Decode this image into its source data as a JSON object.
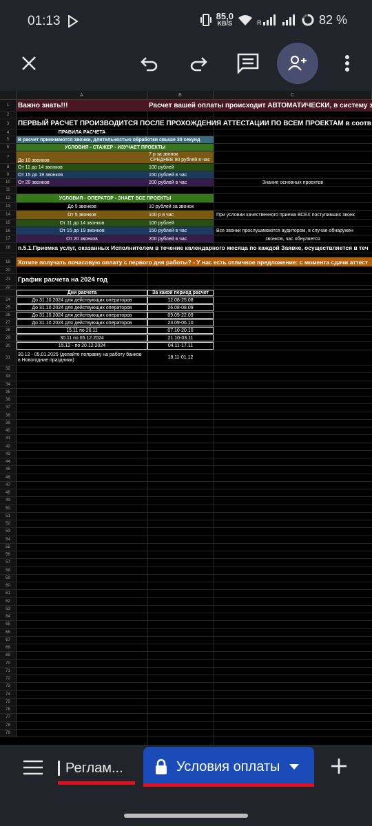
{
  "status_bar": {
    "time": "01:13",
    "speed_value": "85,0",
    "speed_unit": "KB/S",
    "battery": "82 %"
  },
  "toolbar": {
    "icons": [
      "close-icon",
      "undo-icon",
      "redo-icon",
      "comment-icon",
      "share-person-add-icon",
      "more-vert-icon"
    ]
  },
  "sheet": {
    "columns": [
      "A",
      "B",
      "C"
    ],
    "rows": [
      {
        "n": "1",
        "a": "Важно знать!!!",
        "b": "Расчет вашей оплаты происходит АВТОМАТИЧЕСКИ, в систему з",
        "c": ""
      },
      {
        "n": "2",
        "a": "",
        "b": "",
        "c": ""
      },
      {
        "n": "3",
        "a": "ПЕРВЫЙ РАСЧЕТ ПРОИЗВОДИТСЯ ПОСЛЕ ПРОХОЖДЕНИЯ АТТЕСТАЦИИ ПО ВСЕМ ПРОЕКТАМ в соотв",
        "b": "",
        "c": ""
      },
      {
        "n": "4",
        "a": "ПРАВИЛА РАСЧЕТА",
        "b": "",
        "c": ""
      },
      {
        "n": "5",
        "a": "В расчет принимаются звонки, длительностью обработки свыше 30 секунд",
        "b": "",
        "c": ""
      },
      {
        "n": "6",
        "a": "УСЛОВИЯ - СТАЖЕР - ИЗУЧАЕТ ПРОЕКТЫ",
        "b": "",
        "c": ""
      },
      {
        "n": "7",
        "a": "До 10 звонков",
        "b": "7 р за звонок",
        "b2": "СРЕДНЕЕ 90 рублей в час",
        "c": ""
      },
      {
        "n": "8",
        "a": "От 11 до 14 звонков",
        "b": "100 рублей",
        "c": ""
      },
      {
        "n": "9",
        "a": "От 15 до 19 звонков",
        "b": "150 рублей в час",
        "c": ""
      },
      {
        "n": "10",
        "a": "От 20 звонков",
        "b": "200 рублей в час",
        "c": "Знание основных проектов"
      },
      {
        "n": "11",
        "a": "",
        "b": "",
        "c": ""
      },
      {
        "n": "12",
        "a": "УСЛОВИЯ - ОПЕРАТОР - ЗНАЕТ ВСЕ ПРОЕКТЫ",
        "b": "",
        "c": ""
      },
      {
        "n": "13",
        "a": "До 5 звонков",
        "b": "10 рублей за звонок",
        "c": ""
      },
      {
        "n": "14",
        "a": "От 5 звонков",
        "b": "100 р в час",
        "c": "При условии качественного приема ВСЕХ поступивших звонк"
      },
      {
        "n": "15",
        "a": "От 11 до 14 звонков",
        "b": "100 рублей",
        "c": ""
      },
      {
        "n": "16",
        "a": "От 15 до 19 звонков",
        "b": "150 рублей в час",
        "c": "Все звонки прослушиваются аудитором, в случае обнаружен"
      },
      {
        "n": "17",
        "a": "От 20 звонков",
        "b": "200 рублей в час",
        "c": "звонков, час обнуляется"
      },
      {
        "n": "18",
        "a": "п.5.1.Приемка услуг, оказанных Исполнителем в течение календарного месяца по каждой Заявке, осуществляется в теч",
        "b": "",
        "c": ""
      },
      {
        "n": "19",
        "a": "Хотите получать почасовую оплату с первого дня работы? - У нас есть отличное предложение: с момента сдачи аттест",
        "b": "",
        "c": ""
      },
      {
        "n": "20",
        "a": "",
        "b": "",
        "c": ""
      },
      {
        "n": "21",
        "a": "График расчета на 2024 год",
        "b": "",
        "c": ""
      },
      {
        "n": "22",
        "a": "Дни расчета",
        "b": "За какой период расчет",
        "c": ""
      },
      {
        "n": "24",
        "a": "До 31.10.2024  для действующих операторов",
        "b": "12.08-25.08",
        "c": ""
      },
      {
        "n": "25",
        "a": "До 31.10.2024  для действующих операторов",
        "b": "26.08-08.09",
        "c": ""
      },
      {
        "n": "26",
        "a": "До 31.10.2024  для действующих операторов",
        "b": "09.09-22.09",
        "c": ""
      },
      {
        "n": "27",
        "a": "До 31.10.2024  для действующих операторов",
        "b": "23.09-06.10",
        "c": ""
      },
      {
        "n": "28",
        "a": "15.11 по 20.11",
        "b": "07.10-20.10",
        "c": ""
      },
      {
        "n": "29",
        "a": "30.11 по 05.12.2024",
        "b": "21.10-03.11",
        "c": ""
      },
      {
        "n": "30",
        "a": "15.12 - по 20.12.2024",
        "b": "04.11-17.11",
        "c": ""
      },
      {
        "n": "31",
        "a": "30.12 - 05.01.2025 (делайте поправку на работу банков",
        "a2": "в Новогодние праздники)",
        "b": "18.11-01.12",
        "c": ""
      }
    ],
    "empty_row_numbers": [
      "32",
      "33",
      "34",
      "35",
      "36",
      "37",
      "38",
      "39",
      "40",
      "41",
      "42",
      "43",
      "44",
      "45",
      "46",
      "47",
      "48",
      "49",
      "50",
      "51",
      "52",
      "53",
      "54",
      "55",
      "56",
      "57",
      "58",
      "59",
      "60",
      "61",
      "62",
      "63",
      "64",
      "65",
      "66",
      "67",
      "68",
      "69",
      "70",
      "71",
      "72",
      "73",
      "74",
      "75",
      "76",
      "77",
      "78",
      "79"
    ],
    "colors": {
      "row1_a_bg": "#4a1622",
      "row5_bg": "#3d6b80",
      "stazher_header_bg": "#38761d",
      "row7_bg": "#7a5a12",
      "row8_bg": "#274e13",
      "row9_bg": "#1c3a5e",
      "row10_bg": "#351c4a",
      "orange_bg": "#b45f06"
    }
  },
  "bottom_tabs": {
    "menu_icon": "menu-icon",
    "tab1_label": "Реглам...",
    "tab2_label": "Условия оплаты",
    "tab2_icon": "lock-icon",
    "dropdown_icon": "dropdown-arrow-icon",
    "add_icon": "add-sheet-icon"
  }
}
